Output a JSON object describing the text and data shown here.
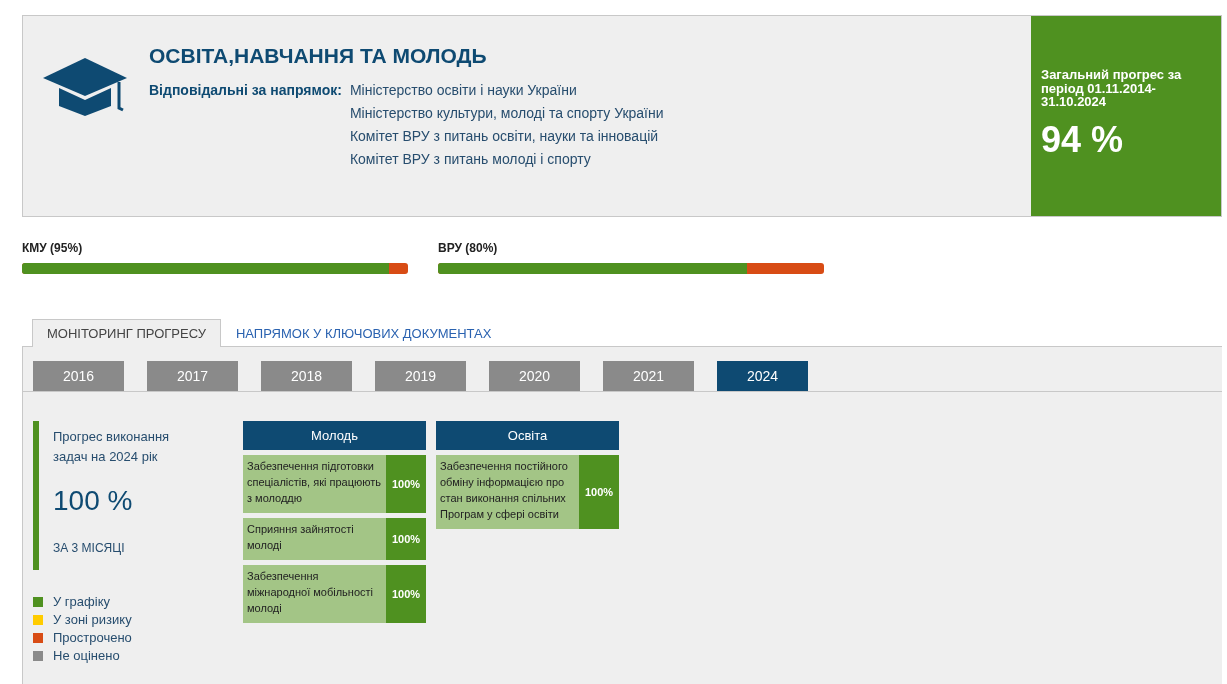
{
  "header": {
    "title": "ОСВІТА,НАВЧАННЯ ТА МОЛОДЬ",
    "responsible_label": "Відповідальні за напрямок:",
    "responsible": [
      "Міністерство освіти і науки України",
      "Міністерство культури, молоді та спорту України",
      "Комітет ВРУ з питань освіти, науки та інновацій",
      "Комітет ВРУ з питань молоді і спорту"
    ]
  },
  "overall": {
    "label": "Загальний прогрес за період 01.11.2014-31.10.2024",
    "value": "94 %"
  },
  "bars": [
    {
      "label": "КМУ (95%)",
      "level": 0.95
    },
    {
      "label": "ВРУ (80%)",
      "level": 0.8
    }
  ],
  "tabs": [
    {
      "label": "МОНІТОРИНГ ПРОГРЕСУ",
      "selected": true
    },
    {
      "label": "НАПРЯМОК У КЛЮЧОВИХ ДОКУМЕНТАХ",
      "selected": false
    }
  ],
  "years": [
    {
      "label": "2016",
      "selected": false
    },
    {
      "label": "2017",
      "selected": false
    },
    {
      "label": "2018",
      "selected": false
    },
    {
      "label": "2019",
      "selected": false
    },
    {
      "label": "2020",
      "selected": false
    },
    {
      "label": "2021",
      "selected": false
    },
    {
      "label": "2024",
      "selected": true
    }
  ],
  "summary": {
    "label": "Прогрес виконання задач на 2024 рік",
    "value": "100 %",
    "period": "ЗА 3 МІСЯЦІ"
  },
  "legend": [
    {
      "label": "У графіку",
      "color": "#4f9120"
    },
    {
      "label": "У зоні ризику",
      "color": "#ffcc00"
    },
    {
      "label": "Прострочено",
      "color": "#d84c15"
    },
    {
      "label": "Не оцінено",
      "color": "#8a8a8a"
    }
  ],
  "groups": [
    {
      "title": "Молодь",
      "tasks": [
        {
          "text": "Забезпечення підготовки спеціалістів, які працюють з молоддю",
          "value": "100%"
        },
        {
          "text": "Сприяння зайнятості молоді",
          "value": "100%"
        },
        {
          "text": "Забезпечення міжнародної мобільності молоді",
          "value": "100%"
        }
      ]
    },
    {
      "title": "Освіта",
      "tasks": [
        {
          "text": "Забезпечення постійного обміну інформацією про стан виконання спільних Програм у сфері освіти",
          "value": "100%"
        }
      ]
    }
  ]
}
